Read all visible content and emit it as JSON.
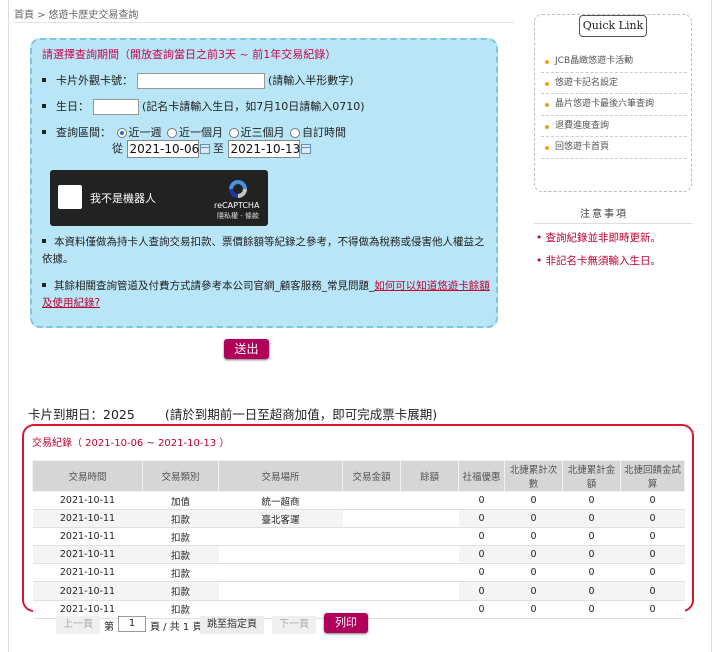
{
  "breadcrumb": {
    "home": "首頁",
    "current": "悠遊卡歷史交易查詢"
  },
  "query": {
    "title": "請選擇查詢期間（開放查詢當日之前3天 ~ 前1年交易紀錄）",
    "card_label": "卡片外觀卡號：",
    "card_value": "",
    "card_hint": "(請輸入半形數字)",
    "birthday_label": "生日：",
    "birthday_value": "",
    "birthday_hint": "(記名卡請輸入生日，如7月10日請輸入0710)",
    "range_label": "查詢區間：",
    "range_options": [
      "近一週",
      "近一個月",
      "近三個月",
      "自訂時間"
    ],
    "range_selected": "近一週",
    "from_label": "從",
    "from_date": "2021-10-06",
    "to_label": "至",
    "to_date": "2021-10-13",
    "notes": [
      "本資料僅做為持卡人查詢交易扣款、票價餘額等紀錄之參考，不得做為稅務或侵害他人權益之依據。",
      "其餘相關查詢管道及付費方式請參考本公司官網_顧客服務_常見問題_"
    ],
    "note_link": "如何可以知道悠遊卡餘額及使用紀錄?",
    "submit_label": "送出"
  },
  "recaptcha": {
    "label": "我不是機器人",
    "brand": "reCAPTCHA",
    "terms": "隱私權 - 條款"
  },
  "sidebar": {
    "quick_link_title": "Quick Link",
    "links": [
      "JCB晶緻悠遊卡活動",
      "悠遊卡記名設定",
      "晶片悠遊卡最後六筆查詢",
      "退費進度查詢",
      "回悠遊卡首頁"
    ],
    "notice_title": "注意事項",
    "notices": [
      "查詢紀錄並非即時更新。",
      "非記名卡無須輸入生日。"
    ]
  },
  "expiry": {
    "label": "卡片到期日：2025",
    "hint": "(請於到期前一日至超商加值，即可完成票卡展期)"
  },
  "records": {
    "title": "交易紀錄（ 2021-10-06 ~ 2021-10-13 ）",
    "columns": [
      "交易時間",
      "交易類別",
      "交易場所",
      "交易金額",
      "餘額",
      "社福優惠",
      "北捷累計次數",
      "北捷累計金額",
      "北捷回饋金試算"
    ],
    "rows": [
      [
        "2021-10-11",
        "加值",
        "統一超商",
        "",
        "",
        "0",
        "0",
        "0",
        "0"
      ],
      [
        "2021-10-11",
        "扣款",
        "臺北客運",
        "",
        "",
        "0",
        "0",
        "0",
        "0"
      ],
      [
        "2021-10-11",
        "扣款",
        "",
        "",
        "",
        "0",
        "0",
        "0",
        "0"
      ],
      [
        "2021-10-11",
        "扣款",
        "",
        "",
        "",
        "0",
        "0",
        "0",
        "0"
      ],
      [
        "2021-10-11",
        "扣款",
        "",
        "",
        "",
        "0",
        "0",
        "0",
        "0"
      ],
      [
        "2021-10-11",
        "扣款",
        "",
        "",
        "",
        "0",
        "0",
        "0",
        "0"
      ],
      [
        "2021-10-11",
        "扣款",
        "",
        "",
        "",
        "0",
        "0",
        "0",
        "0"
      ]
    ]
  },
  "pager": {
    "prev": "上一頁",
    "page_prefix": "第",
    "page_value": "1",
    "page_suffix": "頁 / 共 1 頁",
    "jump": "跳至指定頁",
    "next": "下一頁",
    "print": "列印"
  },
  "colors": {
    "accent": "#b0005a",
    "panel": "#b9e6f7",
    "warning": "#c00030",
    "records_border": "#d8182f"
  }
}
